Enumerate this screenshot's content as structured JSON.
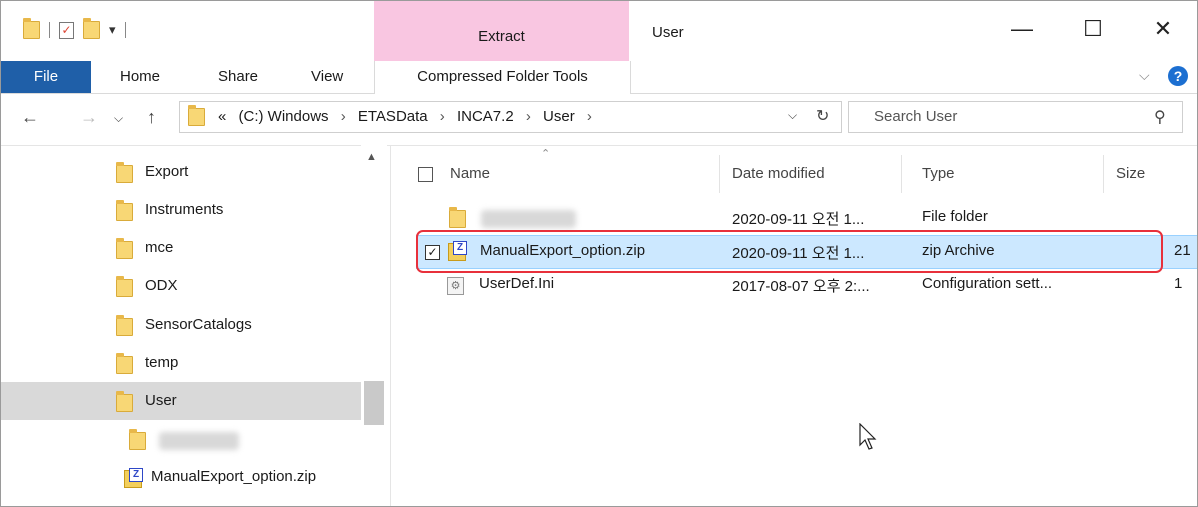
{
  "window": {
    "title": "User"
  },
  "ribbon": {
    "context_header": "Extract",
    "tabs": [
      "File",
      "Home",
      "Share",
      "View",
      "Compressed Folder Tools"
    ],
    "help_label": "?"
  },
  "address": {
    "overflow": "«",
    "crumbs": [
      "(C:) Windows",
      "ETASData",
      "INCA7.2",
      "User"
    ],
    "search_placeholder": "Search User"
  },
  "nav": {
    "items": [
      "Export",
      "Instruments",
      "mce",
      "ODX",
      "SensorCatalogs",
      "temp",
      "User",
      "",
      "ManualExport_option.zip"
    ],
    "selected_index": 6
  },
  "list": {
    "columns": {
      "name": "Name",
      "date": "Date modified",
      "type": "Type",
      "size": "Size"
    },
    "rows": [
      {
        "name": "",
        "date": "2020-09-11 오전 1...",
        "type": "File folder",
        "size": ""
      },
      {
        "name": "ManualExport_option.zip",
        "date": "2020-09-11 오전 1...",
        "type": "zip Archive",
        "size": "21"
      },
      {
        "name": "UserDef.Ini",
        "date": "2017-08-07 오후 2:...",
        "type": "Configuration sett...",
        "size": "1"
      }
    ],
    "selected_row": 1
  },
  "colors": {
    "file_tab": "#1f5fa8",
    "context_tab": "#f9c6e1",
    "selection": "#cce8ff",
    "highlight": "#e8303b"
  }
}
